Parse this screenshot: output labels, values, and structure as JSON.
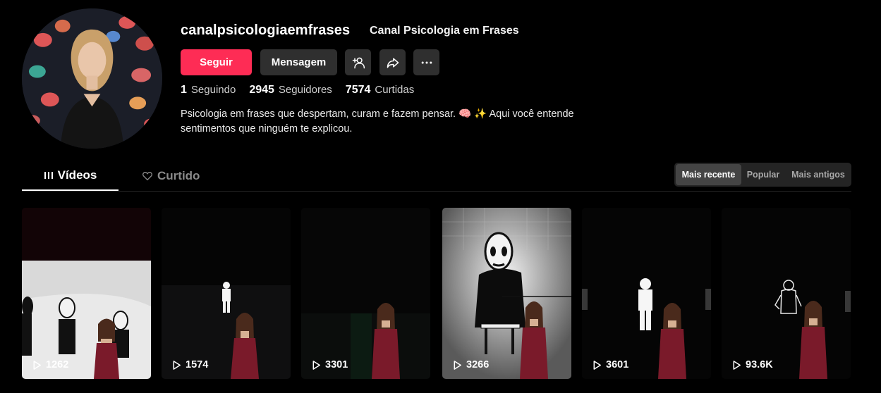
{
  "profile": {
    "username": "canalpsicologiaemfrases",
    "nickname": "Canal Psicologia em Frases",
    "bio": "Psicologia em frases que despertam, curam e fazem pensar. 🧠 ✨ Aqui você entende sentimentos que ninguém te explicou.",
    "avatar_icon": "avatar-image"
  },
  "actions": {
    "follow_label": "Seguir",
    "message_label": "Mensagem",
    "add_friend_icon": "add-friend-icon",
    "share_icon": "share-icon",
    "more_icon": "more-icon"
  },
  "stats": {
    "following": {
      "num": "1",
      "label": "Seguindo"
    },
    "followers": {
      "num": "2945",
      "label": "Seguidores"
    },
    "likes": {
      "num": "7574",
      "label": "Curtidas"
    }
  },
  "tabs": {
    "videos": "Vídeos",
    "liked": "Curtido"
  },
  "sort": {
    "options": [
      "Mais recente",
      "Popular",
      "Mais antigos"
    ],
    "active": "Mais recente"
  },
  "videos": [
    {
      "views": "1262"
    },
    {
      "views": "1574"
    },
    {
      "views": "3301"
    },
    {
      "views": "3266"
    },
    {
      "views": "3601"
    },
    {
      "views": "93.6K"
    }
  ],
  "colors": {
    "accent": "#fe2c55",
    "button_bg": "#2f2f2f",
    "background": "#000000"
  }
}
